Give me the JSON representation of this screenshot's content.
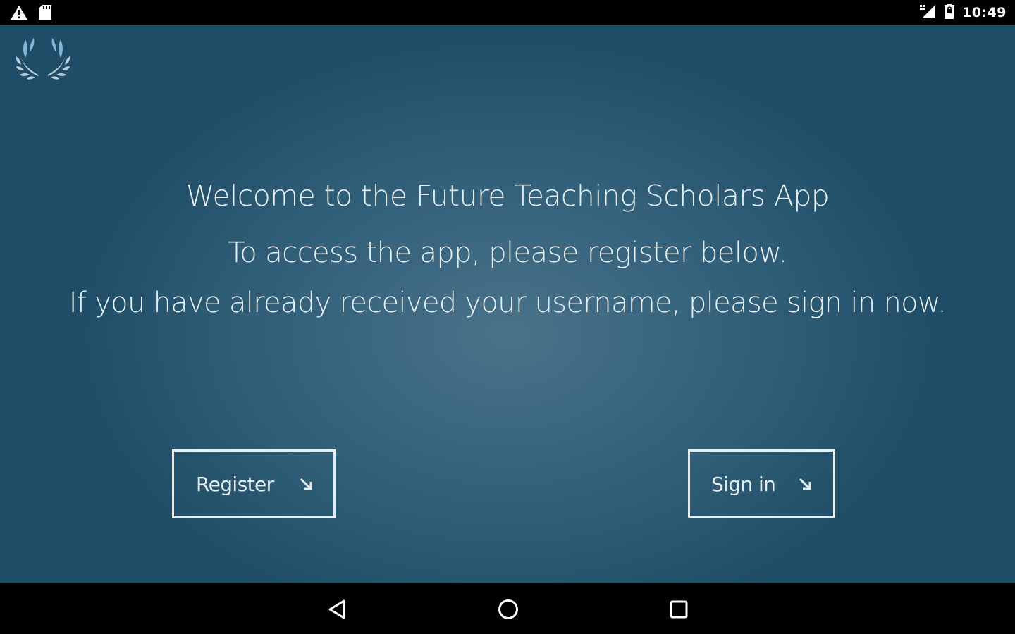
{
  "status_bar": {
    "time": "10:49",
    "left_icons": [
      "warning-icon",
      "sd-card-icon"
    ],
    "right_icons": [
      "signal-icon",
      "battery-icon"
    ]
  },
  "app": {
    "logo_icon": "laurel-wreath-icon",
    "welcome_line1": "Welcome to the Future Teaching Scholars App",
    "welcome_line2": "To access the app, please register below.",
    "welcome_line3": "If you have already received your username, please sign in now.",
    "register_label": "Register",
    "signin_label": "Sign in",
    "button_arrow_icon": "arrow-down-right-icon",
    "colors": {
      "background_center": "#4a7388",
      "background_edge": "#1f4c66",
      "text": "#e6eef2"
    }
  },
  "nav_bar": {
    "icons": [
      "back-icon",
      "home-icon",
      "recents-icon"
    ]
  }
}
